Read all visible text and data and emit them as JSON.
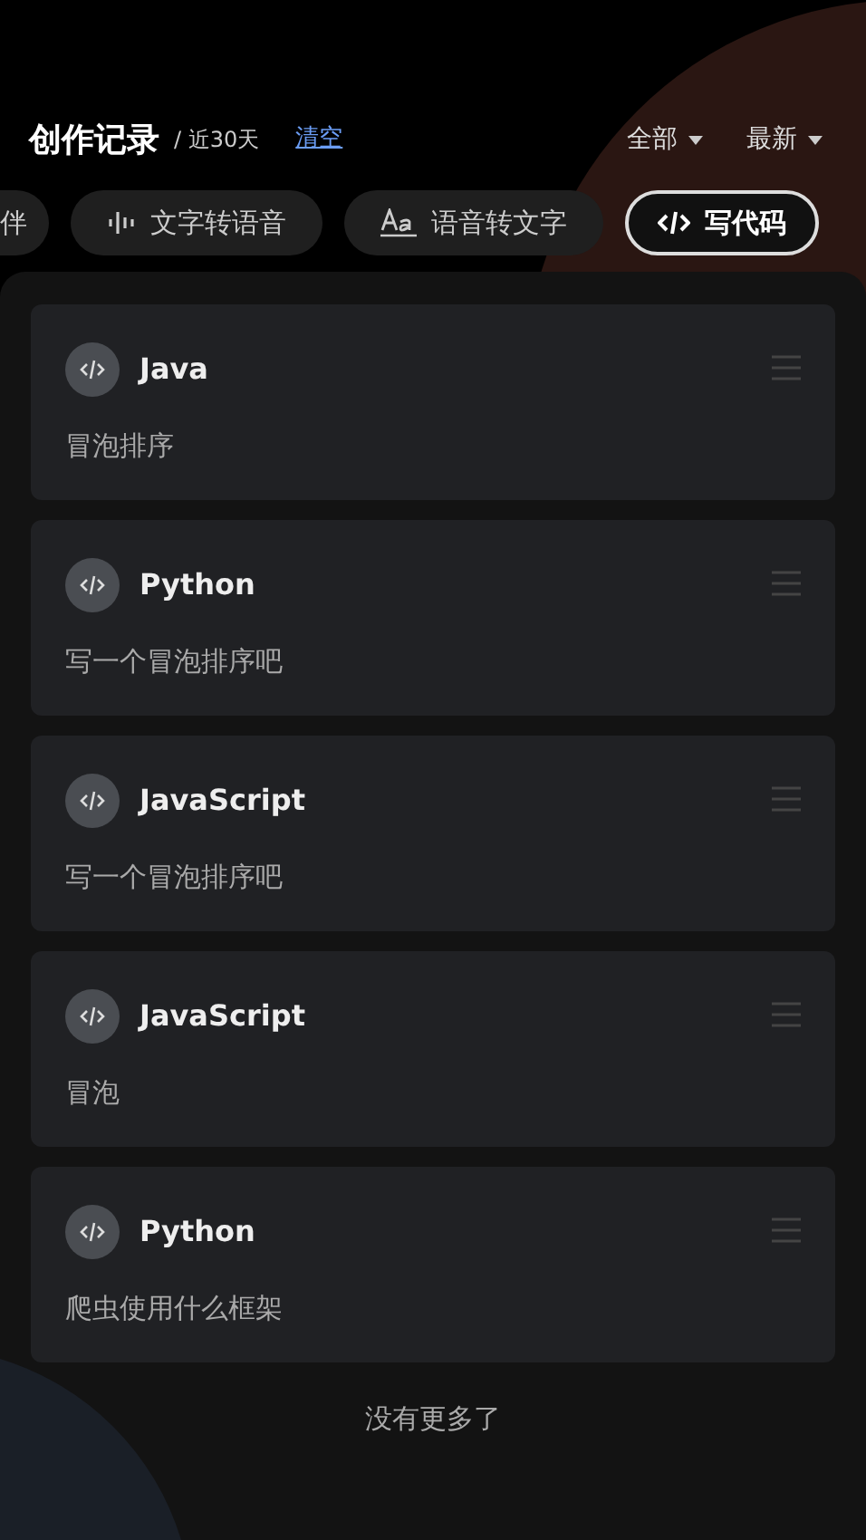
{
  "header": {
    "title": "创作记录",
    "range": "/ 近30天",
    "clear_link": "清空",
    "filters": [
      {
        "label": "全部"
      },
      {
        "label": "最新"
      }
    ]
  },
  "tabs": [
    {
      "label": "伴",
      "kind": "plain",
      "selected": false
    },
    {
      "label": "文字转语音",
      "kind": "voice",
      "selected": false
    },
    {
      "label": "语音转文字",
      "kind": "transcribe",
      "selected": false
    },
    {
      "label": "写代码",
      "kind": "code",
      "selected": true
    }
  ],
  "records": [
    {
      "title": "Java",
      "prompt": "冒泡排序"
    },
    {
      "title": "Python",
      "prompt": "写一个冒泡排序吧"
    },
    {
      "title": "JavaScript",
      "prompt": "写一个冒泡排序吧"
    },
    {
      "title": "JavaScript",
      "prompt": "冒泡"
    },
    {
      "title": "Python",
      "prompt": "爬虫使用什么框架"
    }
  ],
  "footer": "没有更多了"
}
